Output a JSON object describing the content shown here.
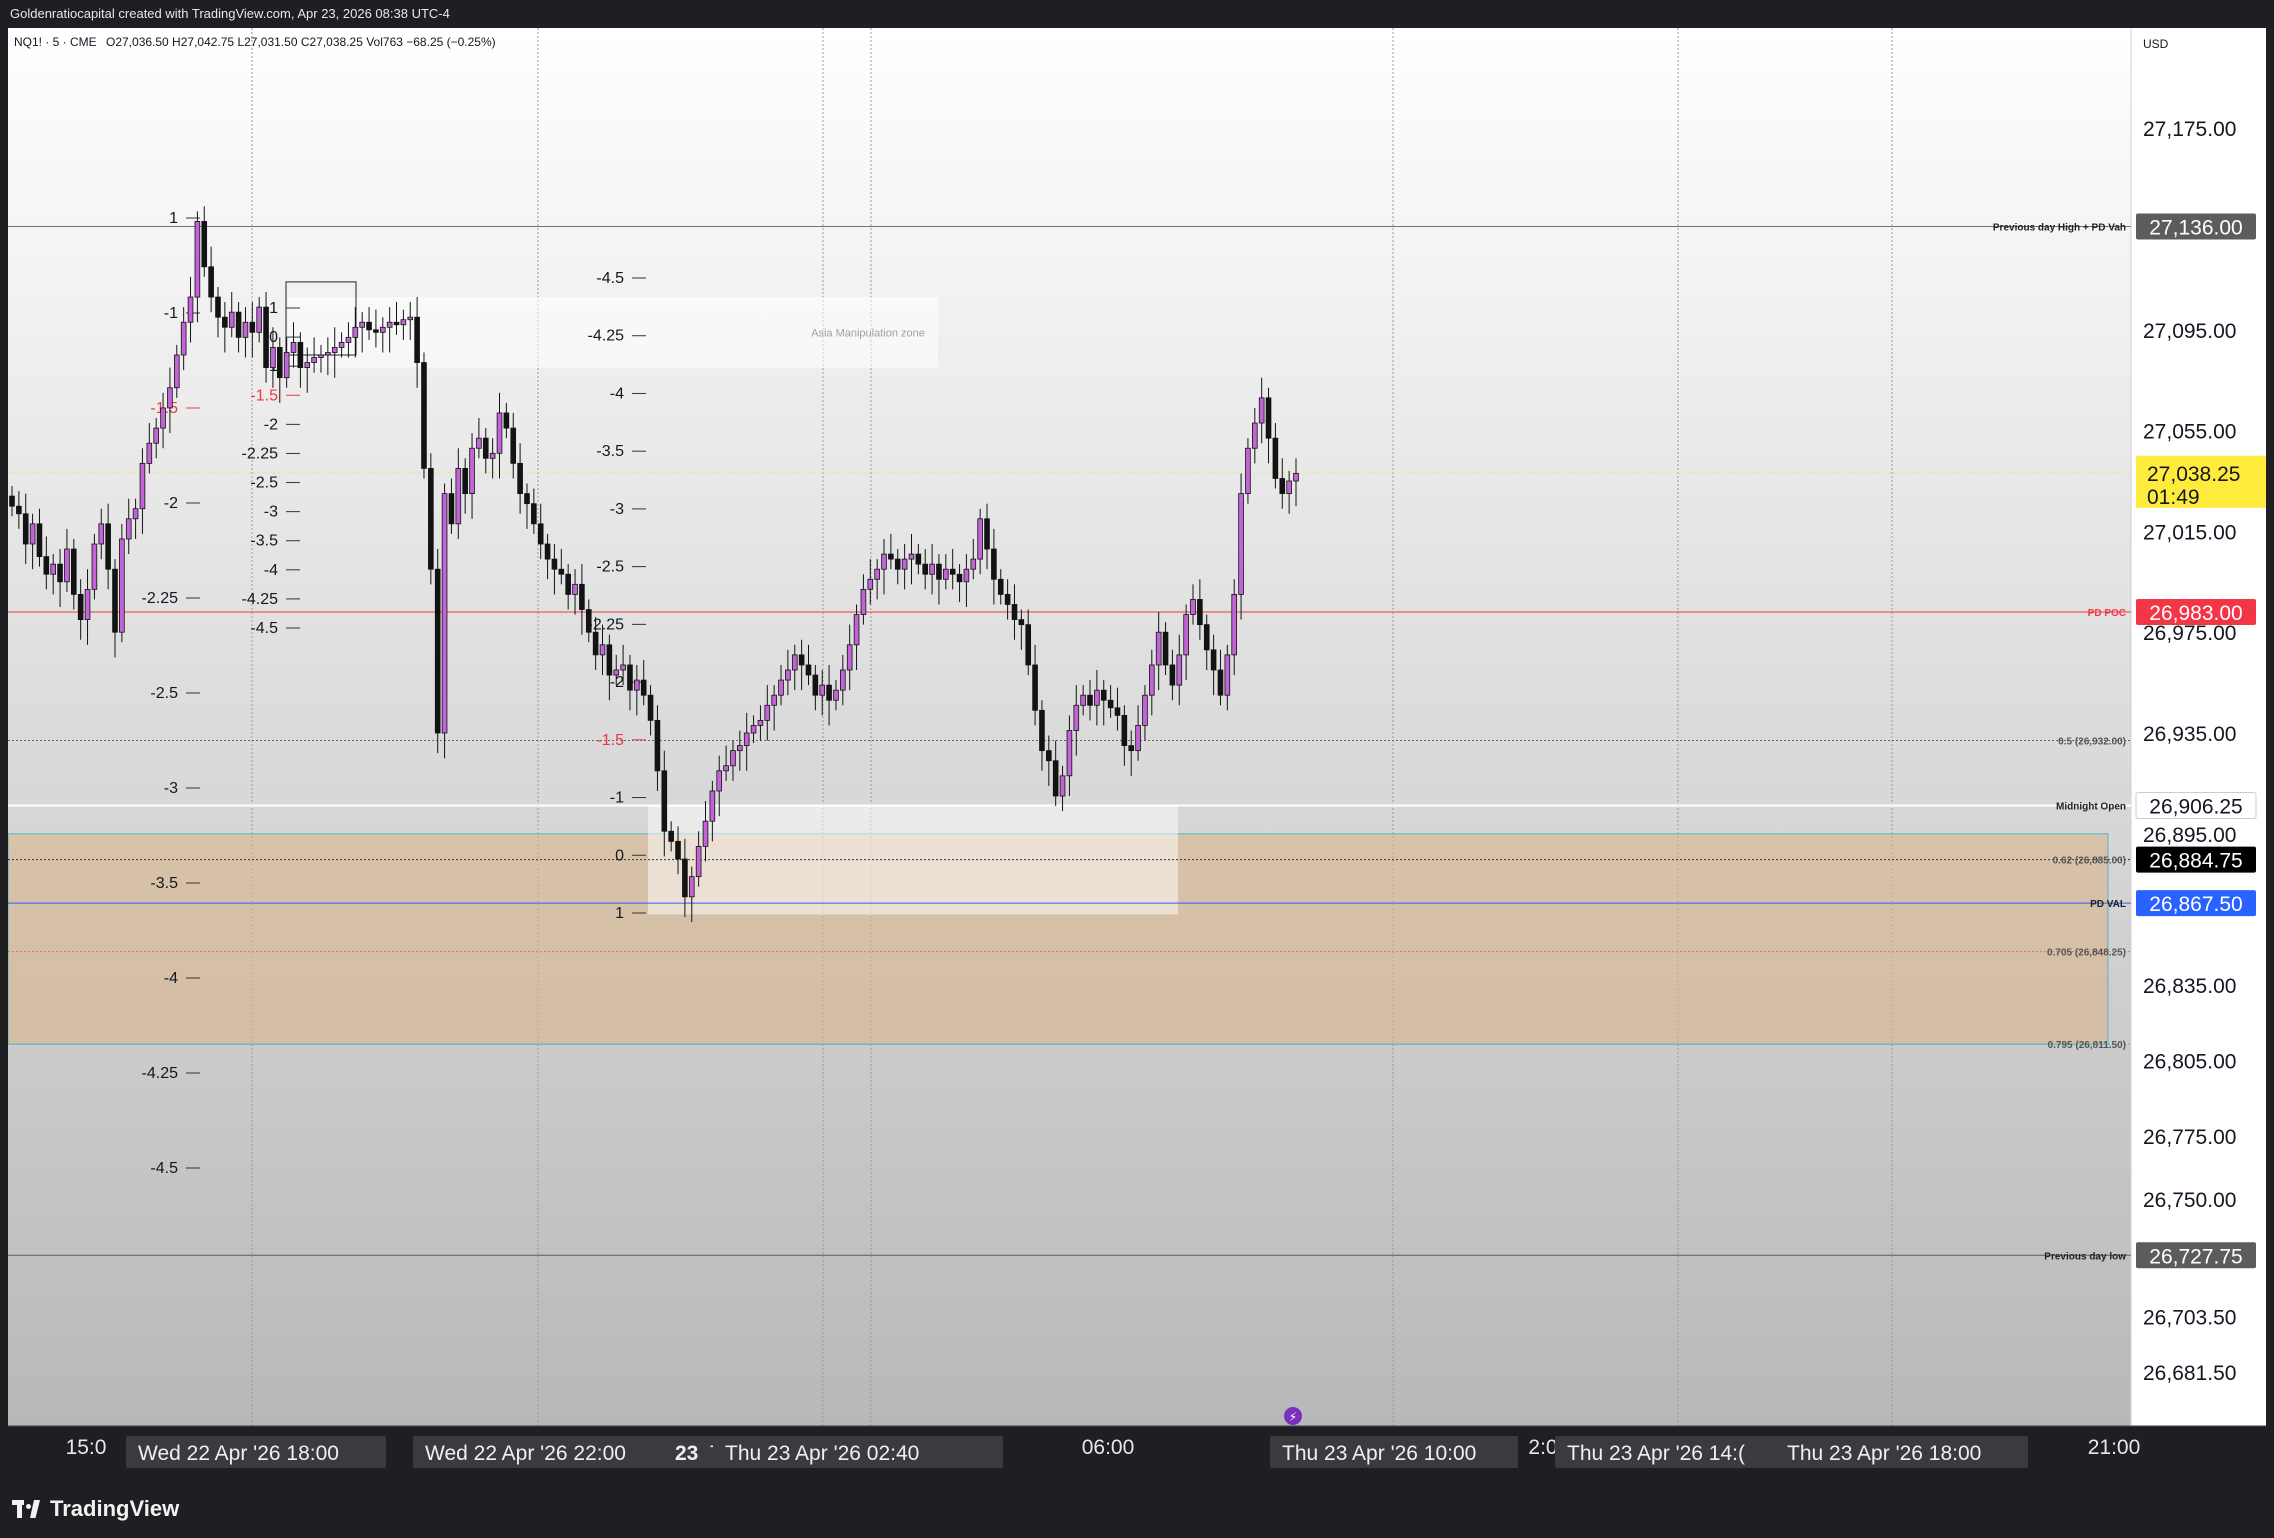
{
  "header": {
    "attribution": "Goldenratiocapital created with TradingView.com, Apr 23, 2026 08:38 UTC-4"
  },
  "footer": {
    "brand": "TradingView"
  },
  "chart_data": {
    "type": "candlestick",
    "symbol_line": "NQ1! · 5 · CME",
    "ohlc_line": "O27,036.50  H27,042.75  L27,031.50  C27,038.25  Vol763  −68.25 (−0.25%)",
    "currency": "USD",
    "ylim": [
      26660,
      27210
    ],
    "y_ticks": [
      "27,175.00",
      "27,095.00",
      "27,055.00",
      "27,015.00",
      "26,975.00",
      "26,935.00",
      "26,895.00",
      "26,835.00",
      "26,805.00",
      "26,775.00",
      "26,750.00",
      "26,703.50",
      "26,681.50"
    ],
    "y_tick_values": [
      27175,
      27095,
      27055,
      27015,
      26975,
      26935,
      26895,
      26835,
      26805,
      26775,
      26750,
      26703.5,
      26681.5
    ],
    "colors": {
      "up": "#c264d6",
      "down": "#131313",
      "poc": "#f23645",
      "val": "#2962ff",
      "last_price": "#ffeb3b",
      "zone": "#d9b48a",
      "zone_border": "#4fb8c9"
    },
    "levels": [
      {
        "label": "Previous day High + PD Vah",
        "tag": "27,136.00",
        "value": 27136,
        "color": "#707070",
        "tag_bg": "#5c5c5c",
        "tag_fg": "#ffffff"
      },
      {
        "label": "PD POC",
        "tag": "26,983.00",
        "value": 26983,
        "color": "#f23645",
        "tag_bg": "#f23645",
        "tag_fg": "#ffffff"
      },
      {
        "label": "0.5 (26,932.00)",
        "tag": "",
        "value": 26932,
        "color": "#666666",
        "tag_bg": "",
        "tag_fg": ""
      },
      {
        "label": "Midnight Open",
        "tag": "26,906.25",
        "value": 26906.25,
        "color": "#ffffff",
        "tag_bg": "#ffffff",
        "tag_fg": "#131722"
      },
      {
        "label": "0.62 (26,885.00)",
        "tag": "26,884.75",
        "value": 26884.75,
        "color": "#333333",
        "tag_bg": "#000000",
        "tag_fg": "#ffffff"
      },
      {
        "label": "PD VAL",
        "tag": "26,867.50",
        "value": 26867.5,
        "color": "#2962ff",
        "tag_bg": "#2962ff",
        "tag_fg": "#ffffff"
      },
      {
        "label": "0.705 (26,848.25)",
        "tag": "",
        "value": 26848.25,
        "color": "#e07070",
        "tag_bg": "",
        "tag_fg": ""
      },
      {
        "label": "0.795 (26,811.50)",
        "tag": "",
        "value": 26811.5,
        "color": "#4fb8c9",
        "tag_bg": "",
        "tag_fg": ""
      },
      {
        "label": "Previous day low",
        "tag": "26,727.75",
        "value": 26727.75,
        "color": "#5c5c5c",
        "tag_bg": "#5c5c5c",
        "tag_fg": "#ffffff"
      }
    ],
    "last_price": {
      "value": 27038.25,
      "tag": "27,038.25",
      "countdown": "01:49"
    },
    "annotation": "Asia Manipulation zone",
    "fib_left": [
      "1",
      "-1",
      "-1.5",
      "-2",
      "-2.25",
      "-2.5",
      "-3",
      "-3.5",
      "-4",
      "-4.25",
      "-4.5"
    ],
    "fib_small": [
      "1",
      "0",
      "-1",
      "-1.5",
      "-2",
      "-2.25",
      "-2.5",
      "-3",
      "-3.5",
      "-4",
      "-4.25",
      "-4.5"
    ],
    "fib_mid": [
      "-4.5",
      "-4.25",
      "-4",
      "-3.5",
      "-3",
      "-2.5",
      "-2.25",
      "-2",
      "-1.5",
      "-1",
      "0",
      "1"
    ],
    "time_labels": [
      "15:0",
      "06:00",
      "2:0",
      "21:00"
    ],
    "time_pills": [
      "Wed 22 Apr '26    18:00",
      "Wed 22 Apr '26    22:00",
      "23",
      "Thu",
      "Thu 23 Apr '26    02:40",
      "Thu 23 Apr '26    10:00",
      "Thu 23 Apr '26    14:(",
      "Thu 23 Apr '26    18:00"
    ],
    "closes": [
      27025,
      27022,
      27010,
      27018,
      27005,
      26998,
      27002,
      26995,
      27008,
      26990,
      26980,
      26992,
      27010,
      27018,
      27000,
      26975,
      27012,
      27020,
      27024,
      27042,
      27050,
      27056,
      27064,
      27072,
      27085,
      27098,
      27108,
      27138,
      27120,
      27108,
      27100,
      27096,
      27102,
      27092,
      27098,
      27094,
      27104,
      27080,
      27088,
      27076,
      27086,
      27090,
      27080,
      27082,
      27084,
      27085,
      27086,
      27088,
      27090,
      27092,
      27096,
      27098,
      27095,
      27094,
      27096,
      27098,
      27097,
      27099,
      27100,
      27082,
      27040,
      27000,
      26935,
      27030,
      27018,
      27040,
      27030,
      27048,
      27052,
      27044,
      27046,
      27062,
      27056,
      27042,
      27030,
      27026,
      27018,
      27010,
      27004,
      27000,
      26998,
      26990,
      26994,
      26984,
      26975,
      26966,
      26970,
      26958,
      26960,
      26962,
      26952,
      26956,
      26950,
      26940,
      26920,
      26896,
      26892,
      26885,
      26870,
      26878,
      26890,
      26900,
      26912,
      26920,
      26922,
      26928,
      26930,
      26935,
      26938,
      26940,
      26946,
      26950,
      26956,
      26960,
      26966,
      26962,
      26958,
      26950,
      26954,
      26948,
      26952,
      26960,
      26970,
      26982,
      26992,
      26996,
      27000,
      27006,
      27004,
      27000,
      27004,
      27006,
      27002,
      26998,
      27002,
      26996,
      27000,
      26998,
      26995,
      27000,
      27004,
      27020,
      27008,
      26996,
      26990,
      26986,
      26980,
      26978,
      26962,
      26944,
      26928,
      26924,
      26910,
      26918,
      26936,
      26946,
      26950,
      26946,
      26952,
      26948,
      26945,
      26942,
      26930,
      26928,
      26938,
      26950,
      26962,
      26975,
      26962,
      26954,
      26966,
      26982,
      26988,
      26978,
      26968,
      26960,
      26950,
      26966,
      26990,
      27030,
      27048,
      27058,
      27068,
      27052,
      27036,
      27030,
      27035,
      27038
    ]
  }
}
